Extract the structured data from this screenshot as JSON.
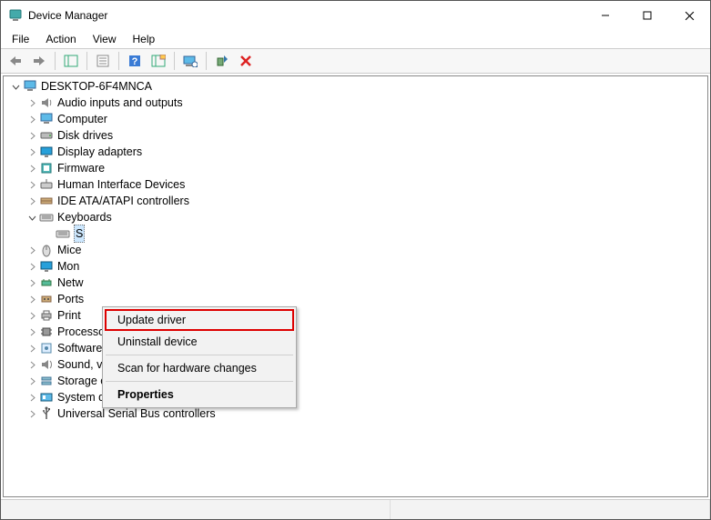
{
  "title": "Device Manager",
  "menubar": {
    "file": "File",
    "action": "Action",
    "view": "View",
    "help": "Help"
  },
  "tree": {
    "root": "DESKTOP-6F4MNCA",
    "items": [
      {
        "label": "Audio inputs and outputs",
        "icon": "audio"
      },
      {
        "label": "Computer",
        "icon": "computer"
      },
      {
        "label": "Disk drives",
        "icon": "disk"
      },
      {
        "label": "Display adapters",
        "icon": "display"
      },
      {
        "label": "Firmware",
        "icon": "firmware"
      },
      {
        "label": "Human Interface Devices",
        "icon": "hid"
      },
      {
        "label": "IDE ATA/ATAPI controllers",
        "icon": "ide"
      },
      {
        "label": "Keyboards",
        "icon": "keyboard",
        "expanded": true,
        "children": [
          {
            "label": "S",
            "icon": "keyboard",
            "selected": true
          }
        ]
      },
      {
        "label": "Mice",
        "icon": "mouse"
      },
      {
        "label": "Mon",
        "icon": "monitor"
      },
      {
        "label": "Netw",
        "icon": "network"
      },
      {
        "label": "Ports",
        "icon": "ports"
      },
      {
        "label": "Print",
        "icon": "printer"
      },
      {
        "label": "Processors",
        "icon": "processor"
      },
      {
        "label": "Software devices",
        "icon": "software"
      },
      {
        "label": "Sound, video and game controllers",
        "icon": "sound"
      },
      {
        "label": "Storage controllers",
        "icon": "storage"
      },
      {
        "label": "System devices",
        "icon": "system"
      },
      {
        "label": "Universal Serial Bus controllers",
        "icon": "usb"
      }
    ]
  },
  "context_menu": {
    "update_driver": "Update driver",
    "uninstall_device": "Uninstall device",
    "scan": "Scan for hardware changes",
    "properties": "Properties"
  }
}
